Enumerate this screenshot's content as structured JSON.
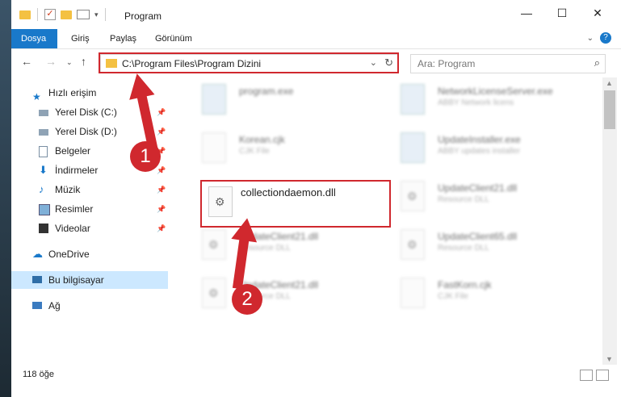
{
  "window": {
    "title": "Program"
  },
  "ribbon": {
    "tabs": [
      "Dosya",
      "Giriş",
      "Paylaş",
      "Görünüm"
    ]
  },
  "address": {
    "path": "C:\\Program Files\\Program Dizini",
    "search_placeholder": "Ara: Program"
  },
  "sidebar": {
    "items": [
      {
        "label": "Hızlı erişim"
      },
      {
        "label": "Yerel Disk (C:)"
      },
      {
        "label": "Yerel Disk (D:)"
      },
      {
        "label": "Belgeler"
      },
      {
        "label": "İndirmeler"
      },
      {
        "label": "Müzik"
      },
      {
        "label": "Resimler"
      },
      {
        "label": "Videolar"
      },
      {
        "label": "OneDrive"
      },
      {
        "label": "Bu bilgisayar"
      },
      {
        "label": "Ağ"
      }
    ]
  },
  "files": [
    {
      "name": "program.exe",
      "sub": ""
    },
    {
      "name": "NetworkLicenseServer.exe",
      "sub": "ABBY Network licens"
    },
    {
      "name": "Korean.cjk",
      "sub": "CJK File"
    },
    {
      "name": "UpdateInstaller.exe",
      "sub": "ABBY updates installer"
    },
    {
      "name": "collectiondaemon.dll",
      "sub": ""
    },
    {
      "name": "UpdateClient21.dll",
      "sub": "Resource DLL"
    },
    {
      "name": "UpdateClient21.dll",
      "sub": "Resource DLL"
    },
    {
      "name": "UpdateClient65.dll",
      "sub": "Resource DLL"
    },
    {
      "name": "UpdateClient21.dll",
      "sub": "Resource DLL"
    },
    {
      "name": "FastKorn.cjk",
      "sub": "CJK File"
    }
  ],
  "status": {
    "count": "118 öğe"
  },
  "callouts": [
    "1",
    "2"
  ],
  "colors": {
    "accent": "#1979ca",
    "highlight": "#d0282e",
    "folder": "#f4c142"
  }
}
